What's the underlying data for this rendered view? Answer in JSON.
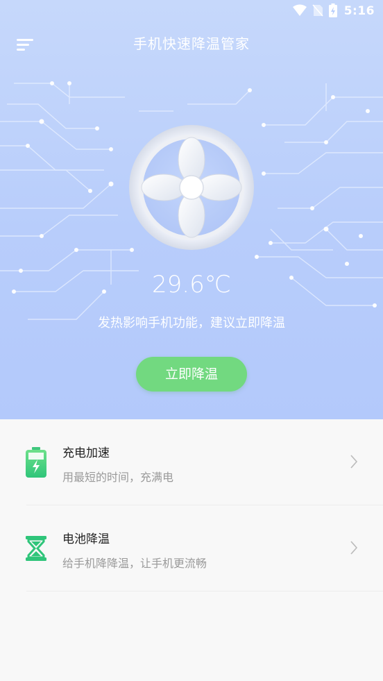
{
  "status_bar": {
    "time": "5:16",
    "icons": [
      "wifi-icon",
      "no-sim-icon",
      "battery-charging-icon"
    ]
  },
  "header": {
    "title": "手机快速降温管家",
    "menu_icon": "menu-icon"
  },
  "hero": {
    "temperature": "29.6℃",
    "tip": "发热影响手机功能，建议立即降温",
    "cool_button": "立即降温",
    "colors": {
      "background": "#b8cdfb",
      "button": "#72d980"
    }
  },
  "features": [
    {
      "title": "充电加速",
      "subtitle": "用最短的时间，充满电",
      "icon": "battery-charging-icon"
    },
    {
      "title": "电池降温",
      "subtitle": "给手机降降温，让手机更流畅",
      "icon": "hourglass-icon"
    }
  ]
}
